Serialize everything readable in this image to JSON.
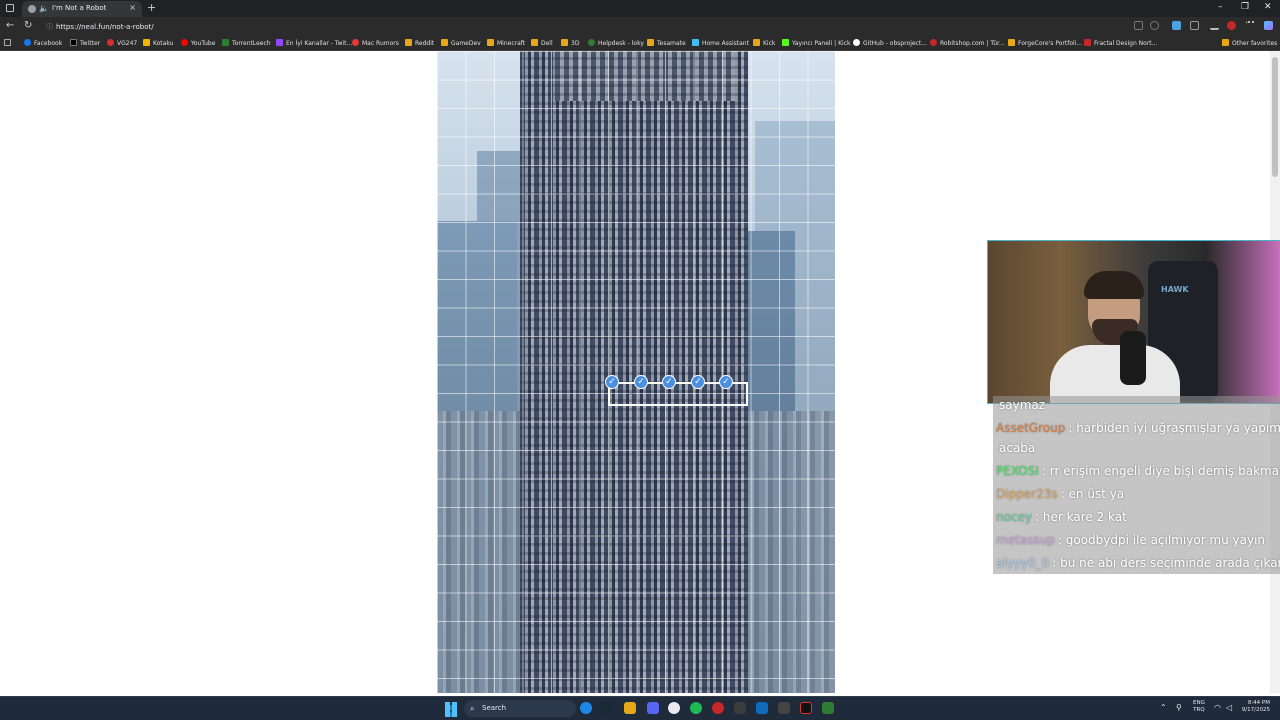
{
  "browser": {
    "tab_title": "I'm Not a Robot",
    "new_tab_symbol": "+",
    "close_symbol": "×",
    "minimize_symbol": "–",
    "maximize_symbol": "❐",
    "window_close_symbol": "✕",
    "url": "https://neal.fun/not-a-robot/",
    "back_symbol": "←",
    "reload_symbol": "↻",
    "lock_symbol": "ⓘ",
    "bookmarks": [
      {
        "label": "Facebook",
        "color": "#1877f2"
      },
      {
        "label": "Twitter",
        "color": "#000000"
      },
      {
        "label": "VG247",
        "color": "#d32f2f"
      },
      {
        "label": "Kotaku",
        "color": "#f4b400"
      },
      {
        "label": "YouTube",
        "color": "#ff0000"
      },
      {
        "label": "TorrentLeech",
        "color": "#2e7d32"
      },
      {
        "label": "En İyi Kanallar - Twit...",
        "color": "#9146ff"
      },
      {
        "label": "Mac Rumors",
        "color": "#e53935"
      },
      {
        "label": "Reddit",
        "color": "#e6a817"
      },
      {
        "label": "GameDev",
        "color": "#e6a817"
      },
      {
        "label": "Minecraft",
        "color": "#e6a817"
      },
      {
        "label": "Dell",
        "color": "#e6a817"
      },
      {
        "label": "3D",
        "color": "#e6a817"
      },
      {
        "label": "Helpdesk - loky",
        "color": "#2e7d32"
      },
      {
        "label": "Tesamate",
        "color": "#e6a817"
      },
      {
        "label": "Home Assistant",
        "color": "#41bdf5"
      },
      {
        "label": "Kick",
        "color": "#e6a817"
      },
      {
        "label": "Yayıncı Paneli | Kick",
        "color": "#53fc18"
      },
      {
        "label": "GitHub - obsproject...",
        "color": "#ffffff"
      },
      {
        "label": "Robitshop.com | Tür...",
        "color": "#c62828"
      },
      {
        "label": "ForgeCore's Portfoli...",
        "color": "#e6a817"
      },
      {
        "label": "Fractal Design Nort...",
        "color": "#c62828"
      }
    ],
    "other_favorites": "Other favorites"
  },
  "chat": {
    "messages": [
      {
        "user": "",
        "text": "saymaz",
        "user_color": "#ffffff"
      },
      {
        "user": "AssetGroup",
        "text": ": harbiden iyi uğraşmışlar ya yapımı",
        "user_color": "#d97a3a"
      },
      {
        "user": "",
        "text": "acaba",
        "user_color": "#ffffff"
      },
      {
        "user": "PEXOSI",
        "text": ": rr erişim engeli diye bişi demiş bakmay",
        "user_color": "#36e65a"
      },
      {
        "user": "Dipper23s",
        "text": ": en üst ya",
        "user_color": "#d9a15a"
      },
      {
        "user": "nocey",
        "text": ": her kare 2 kat",
        "user_color": "#5fc9a0"
      },
      {
        "user": "metassup",
        "text": ": goodbydpi ile açılmıyor mu yayın",
        "user_color": "#c6a2d6"
      },
      {
        "user": "alyyy0_0",
        "text": ": bu ne abi ders seçiminde arada çıkan",
        "user_color": "#a9c4e8"
      }
    ]
  },
  "webcam": {
    "chair_brand": "HAWK"
  },
  "taskbar": {
    "search_placeholder": "Search",
    "language_line1": "ENG",
    "language_line2": "TRQ",
    "time": "8:44 PM",
    "date": "9/17/2025"
  },
  "colors": {
    "check_blue": "#4a90e2",
    "webcam_border": "#4ab3c9"
  }
}
